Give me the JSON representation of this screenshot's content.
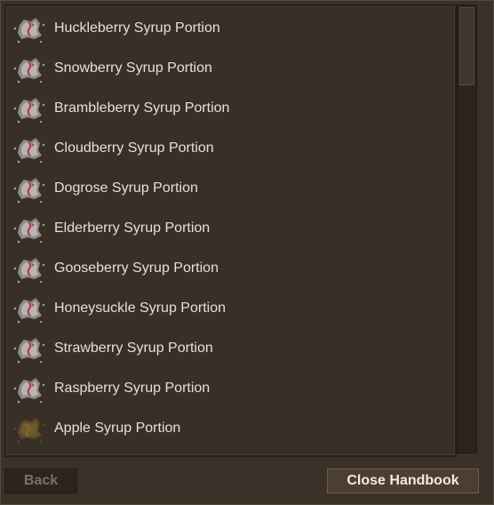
{
  "handbook": {
    "items": [
      {
        "label": "Huckleberry Syrup Portion",
        "icon": "syrup-portion-icon"
      },
      {
        "label": "Snowberry Syrup Portion",
        "icon": "syrup-portion-icon"
      },
      {
        "label": "Brambleberry Syrup Portion",
        "icon": "syrup-portion-icon"
      },
      {
        "label": "Cloudberry Syrup Portion",
        "icon": "syrup-portion-icon"
      },
      {
        "label": "Dogrose Syrup Portion",
        "icon": "syrup-portion-icon"
      },
      {
        "label": "Elderberry Syrup Portion",
        "icon": "syrup-portion-icon"
      },
      {
        "label": "Gooseberry Syrup Portion",
        "icon": "syrup-portion-icon"
      },
      {
        "label": "Honeysuckle Syrup Portion",
        "icon": "syrup-portion-icon"
      },
      {
        "label": "Strawberry Syrup Portion",
        "icon": "syrup-portion-icon"
      },
      {
        "label": "Raspberry Syrup Portion",
        "icon": "syrup-portion-icon"
      },
      {
        "label": "Apple Syrup Portion",
        "icon": "apple-syrup-portion-icon"
      }
    ]
  },
  "footer": {
    "back_label": "Back",
    "close_label": "Close Handbook"
  },
  "colors": {
    "background": "#3a3128",
    "text": "#e8e0d4",
    "button_active": "#4c3f32",
    "button_disabled_text": "#7b7166"
  }
}
